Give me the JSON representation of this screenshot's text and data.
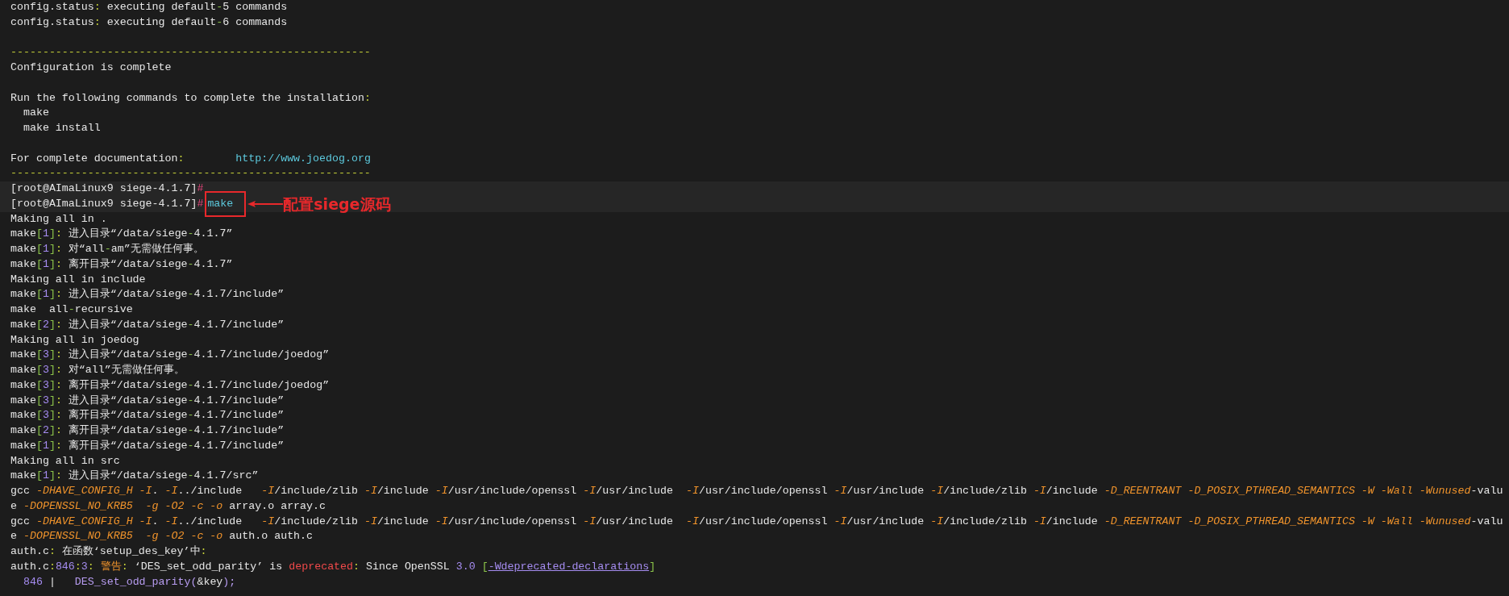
{
  "scrollback": [
    {
      "kind": "text",
      "segments": [
        {
          "text": "config.status",
          "kind": "plain"
        },
        {
          "text": ":",
          "kind": "punct"
        },
        {
          "text": " executing default",
          "kind": "plain"
        },
        {
          "text": "-",
          "kind": "dash"
        },
        {
          "text": "5 commands",
          "kind": "plain"
        }
      ]
    },
    {
      "kind": "text",
      "segments": [
        {
          "text": "config.status",
          "kind": "plain"
        },
        {
          "text": ":",
          "kind": "punct"
        },
        {
          "text": " executing default",
          "kind": "plain"
        },
        {
          "text": "-",
          "kind": "dash"
        },
        {
          "text": "6 commands",
          "kind": "plain"
        }
      ]
    },
    {
      "kind": "blank"
    },
    {
      "kind": "text",
      "segments": [
        {
          "text": "--------------------------------------------------------",
          "kind": "punct"
        }
      ]
    },
    {
      "kind": "text",
      "segments": [
        {
          "text": "Configuration is complete",
          "kind": "plain"
        }
      ]
    },
    {
      "kind": "blank"
    },
    {
      "kind": "text",
      "segments": [
        {
          "text": "Run the following commands to complete the installation",
          "kind": "plain"
        },
        {
          "text": ":",
          "kind": "punct"
        }
      ]
    },
    {
      "kind": "text",
      "segments": [
        {
          "text": "  make",
          "kind": "plain"
        }
      ]
    },
    {
      "kind": "text",
      "segments": [
        {
          "text": "  make install",
          "kind": "plain"
        }
      ]
    },
    {
      "kind": "blank"
    },
    {
      "kind": "text",
      "segments": [
        {
          "text": "For complete documentation",
          "kind": "plain"
        },
        {
          "text": ":        ",
          "kind": "punct"
        },
        {
          "text": "http://www.joedog.org",
          "kind": "url"
        }
      ]
    },
    {
      "kind": "text",
      "segments": [
        {
          "text": "--------------------------------------------------------",
          "kind": "punct"
        }
      ]
    }
  ],
  "highlighted_lines": [
    {
      "kind": "text",
      "segments": [
        {
          "text": "[root@AImaLinux9 siege-4.1.7]",
          "kind": "plain"
        },
        {
          "text": "#",
          "kind": "sign"
        }
      ]
    },
    {
      "kind": "text",
      "segments": [
        {
          "text": "[root@AImaLinux9 siege-4.1.7]",
          "kind": "plain"
        },
        {
          "text": "#",
          "kind": "sign"
        }
      ],
      "annotation": {
        "command": "make",
        "label": "配置siege源码"
      }
    }
  ],
  "output": [
    {
      "kind": "text",
      "segments": [
        {
          "text": "Making all in .",
          "kind": "plain"
        }
      ]
    },
    {
      "kind": "text",
      "segments": [
        {
          "text": "make",
          "kind": "plain"
        },
        {
          "text": "[",
          "kind": "dash"
        },
        {
          "text": "1",
          "kind": "number"
        },
        {
          "text": "]",
          "kind": "dash"
        },
        {
          "text": ":",
          "kind": "punct"
        },
        {
          "text": " 进入目录“/data/siege",
          "kind": "plain"
        },
        {
          "text": "-",
          "kind": "dash"
        },
        {
          "text": "4.1.7”",
          "kind": "plain"
        }
      ]
    },
    {
      "kind": "text",
      "segments": [
        {
          "text": "make",
          "kind": "plain"
        },
        {
          "text": "[",
          "kind": "dash"
        },
        {
          "text": "1",
          "kind": "number"
        },
        {
          "text": "]",
          "kind": "dash"
        },
        {
          "text": ":",
          "kind": "punct"
        },
        {
          "text": " 对“all",
          "kind": "plain"
        },
        {
          "text": "-",
          "kind": "dash"
        },
        {
          "text": "am”无需做任何事。",
          "kind": "plain"
        }
      ]
    },
    {
      "kind": "text",
      "segments": [
        {
          "text": "make",
          "kind": "plain"
        },
        {
          "text": "[",
          "kind": "dash"
        },
        {
          "text": "1",
          "kind": "number"
        },
        {
          "text": "]",
          "kind": "dash"
        },
        {
          "text": ":",
          "kind": "punct"
        },
        {
          "text": " 离开目录“/data/siege",
          "kind": "plain"
        },
        {
          "text": "-",
          "kind": "dash"
        },
        {
          "text": "4.1.7”",
          "kind": "plain"
        }
      ]
    },
    {
      "kind": "text",
      "segments": [
        {
          "text": "Making all in include",
          "kind": "plain"
        }
      ]
    },
    {
      "kind": "text",
      "segments": [
        {
          "text": "make",
          "kind": "plain"
        },
        {
          "text": "[",
          "kind": "dash"
        },
        {
          "text": "1",
          "kind": "number"
        },
        {
          "text": "]",
          "kind": "dash"
        },
        {
          "text": ":",
          "kind": "punct"
        },
        {
          "text": " 进入目录“/data/siege",
          "kind": "plain"
        },
        {
          "text": "-",
          "kind": "dash"
        },
        {
          "text": "4.1.7/include”",
          "kind": "plain"
        }
      ]
    },
    {
      "kind": "text",
      "segments": [
        {
          "text": "make  all",
          "kind": "plain"
        },
        {
          "text": "-",
          "kind": "dash"
        },
        {
          "text": "recursive",
          "kind": "plain"
        }
      ]
    },
    {
      "kind": "text",
      "segments": [
        {
          "text": "make",
          "kind": "plain"
        },
        {
          "text": "[",
          "kind": "dash"
        },
        {
          "text": "2",
          "kind": "number"
        },
        {
          "text": "]",
          "kind": "dash"
        },
        {
          "text": ":",
          "kind": "punct"
        },
        {
          "text": " 进入目录“/data/siege",
          "kind": "plain"
        },
        {
          "text": "-",
          "kind": "dash"
        },
        {
          "text": "4.1.7/include”",
          "kind": "plain"
        }
      ]
    },
    {
      "kind": "text",
      "segments": [
        {
          "text": "Making all in joedog",
          "kind": "plain"
        }
      ]
    },
    {
      "kind": "text",
      "segments": [
        {
          "text": "make",
          "kind": "plain"
        },
        {
          "text": "[",
          "kind": "dash"
        },
        {
          "text": "3",
          "kind": "number"
        },
        {
          "text": "]",
          "kind": "dash"
        },
        {
          "text": ":",
          "kind": "punct"
        },
        {
          "text": " 进入目录“/data/siege",
          "kind": "plain"
        },
        {
          "text": "-",
          "kind": "dash"
        },
        {
          "text": "4.1.7/include/joedog”",
          "kind": "plain"
        }
      ]
    },
    {
      "kind": "text",
      "segments": [
        {
          "text": "make",
          "kind": "plain"
        },
        {
          "text": "[",
          "kind": "dash"
        },
        {
          "text": "3",
          "kind": "number"
        },
        {
          "text": "]",
          "kind": "dash"
        },
        {
          "text": ":",
          "kind": "punct"
        },
        {
          "text": " 对“all”无需做任何事。",
          "kind": "plain"
        }
      ]
    },
    {
      "kind": "text",
      "segments": [
        {
          "text": "make",
          "kind": "plain"
        },
        {
          "text": "[",
          "kind": "dash"
        },
        {
          "text": "3",
          "kind": "number"
        },
        {
          "text": "]",
          "kind": "dash"
        },
        {
          "text": ":",
          "kind": "punct"
        },
        {
          "text": " 离开目录“/data/siege",
          "kind": "plain"
        },
        {
          "text": "-",
          "kind": "dash"
        },
        {
          "text": "4.1.7/include/joedog”",
          "kind": "plain"
        }
      ]
    },
    {
      "kind": "text",
      "segments": [
        {
          "text": "make",
          "kind": "plain"
        },
        {
          "text": "[",
          "kind": "dash"
        },
        {
          "text": "3",
          "kind": "number"
        },
        {
          "text": "]",
          "kind": "dash"
        },
        {
          "text": ":",
          "kind": "punct"
        },
        {
          "text": " 进入目录“/data/siege",
          "kind": "plain"
        },
        {
          "text": "-",
          "kind": "dash"
        },
        {
          "text": "4.1.7/include”",
          "kind": "plain"
        }
      ]
    },
    {
      "kind": "text",
      "segments": [
        {
          "text": "make",
          "kind": "plain"
        },
        {
          "text": "[",
          "kind": "dash"
        },
        {
          "text": "3",
          "kind": "number"
        },
        {
          "text": "]",
          "kind": "dash"
        },
        {
          "text": ":",
          "kind": "punct"
        },
        {
          "text": " 离开目录“/data/siege",
          "kind": "plain"
        },
        {
          "text": "-",
          "kind": "dash"
        },
        {
          "text": "4.1.7/include”",
          "kind": "plain"
        }
      ]
    },
    {
      "kind": "text",
      "segments": [
        {
          "text": "make",
          "kind": "plain"
        },
        {
          "text": "[",
          "kind": "dash"
        },
        {
          "text": "2",
          "kind": "number"
        },
        {
          "text": "]",
          "kind": "dash"
        },
        {
          "text": ":",
          "kind": "punct"
        },
        {
          "text": " 离开目录“/data/siege",
          "kind": "plain"
        },
        {
          "text": "-",
          "kind": "dash"
        },
        {
          "text": "4.1.7/include”",
          "kind": "plain"
        }
      ]
    },
    {
      "kind": "text",
      "segments": [
        {
          "text": "make",
          "kind": "plain"
        },
        {
          "text": "[",
          "kind": "dash"
        },
        {
          "text": "1",
          "kind": "number"
        },
        {
          "text": "]",
          "kind": "dash"
        },
        {
          "text": ":",
          "kind": "punct"
        },
        {
          "text": " 离开目录“/data/siege",
          "kind": "plain"
        },
        {
          "text": "-",
          "kind": "dash"
        },
        {
          "text": "4.1.7/include”",
          "kind": "plain"
        }
      ]
    },
    {
      "kind": "text",
      "segments": [
        {
          "text": "Making all in src",
          "kind": "plain"
        }
      ]
    },
    {
      "kind": "text",
      "segments": [
        {
          "text": "make",
          "kind": "plain"
        },
        {
          "text": "[",
          "kind": "dash"
        },
        {
          "text": "1",
          "kind": "number"
        },
        {
          "text": "]",
          "kind": "dash"
        },
        {
          "text": ":",
          "kind": "punct"
        },
        {
          "text": " 进入目录“/data/siege",
          "kind": "plain"
        },
        {
          "text": "-",
          "kind": "dash"
        },
        {
          "text": "4.1.7/src”",
          "kind": "plain"
        }
      ]
    },
    {
      "kind": "text",
      "segments": [
        {
          "text": "gcc ",
          "kind": "plain"
        },
        {
          "text": "-DHAVE_CONFIG_H -I",
          "kind": "flag"
        },
        {
          "text": ". ",
          "kind": "plain"
        },
        {
          "text": "-I",
          "kind": "flag"
        },
        {
          "text": "../include   ",
          "kind": "plain"
        },
        {
          "text": "-I",
          "kind": "flag"
        },
        {
          "text": "/include/zlib ",
          "kind": "plain"
        },
        {
          "text": "-I",
          "kind": "flag"
        },
        {
          "text": "/include ",
          "kind": "plain"
        },
        {
          "text": "-I",
          "kind": "flag"
        },
        {
          "text": "/usr/include/openssl ",
          "kind": "plain"
        },
        {
          "text": "-I",
          "kind": "flag"
        },
        {
          "text": "/usr/include  ",
          "kind": "plain"
        },
        {
          "text": "-I",
          "kind": "flag"
        },
        {
          "text": "/usr/include/openssl ",
          "kind": "plain"
        },
        {
          "text": "-I",
          "kind": "flag"
        },
        {
          "text": "/usr/include ",
          "kind": "plain"
        },
        {
          "text": "-I",
          "kind": "flag"
        },
        {
          "text": "/include/zlib ",
          "kind": "plain"
        },
        {
          "text": "-I",
          "kind": "flag"
        },
        {
          "text": "/include ",
          "kind": "plain"
        },
        {
          "text": "-D_REENTRANT -D_POSIX_PTHREAD_SEMANTICS -W -Wall -Wunused",
          "kind": "flag"
        },
        {
          "text": "-valu",
          "kind": "plain"
        }
      ]
    },
    {
      "kind": "text",
      "segments": [
        {
          "text": "e ",
          "kind": "plain"
        },
        {
          "text": "-DOPENSSL_NO_KRB5  -g -O2 -c -o",
          "kind": "flag"
        },
        {
          "text": " array.o array.c",
          "kind": "plain"
        }
      ]
    },
    {
      "kind": "text",
      "segments": [
        {
          "text": "gcc ",
          "kind": "plain"
        },
        {
          "text": "-DHAVE_CONFIG_H -I",
          "kind": "flag"
        },
        {
          "text": ". ",
          "kind": "plain"
        },
        {
          "text": "-I",
          "kind": "flag"
        },
        {
          "text": "../include   ",
          "kind": "plain"
        },
        {
          "text": "-I",
          "kind": "flag"
        },
        {
          "text": "/include/zlib ",
          "kind": "plain"
        },
        {
          "text": "-I",
          "kind": "flag"
        },
        {
          "text": "/include ",
          "kind": "plain"
        },
        {
          "text": "-I",
          "kind": "flag"
        },
        {
          "text": "/usr/include/openssl ",
          "kind": "plain"
        },
        {
          "text": "-I",
          "kind": "flag"
        },
        {
          "text": "/usr/include  ",
          "kind": "plain"
        },
        {
          "text": "-I",
          "kind": "flag"
        },
        {
          "text": "/usr/include/openssl ",
          "kind": "plain"
        },
        {
          "text": "-I",
          "kind": "flag"
        },
        {
          "text": "/usr/include ",
          "kind": "plain"
        },
        {
          "text": "-I",
          "kind": "flag"
        },
        {
          "text": "/include/zlib ",
          "kind": "plain"
        },
        {
          "text": "-I",
          "kind": "flag"
        },
        {
          "text": "/include ",
          "kind": "plain"
        },
        {
          "text": "-D_REENTRANT -D_POSIX_PTHREAD_SEMANTICS -W -Wall -Wunused",
          "kind": "flag"
        },
        {
          "text": "-valu",
          "kind": "plain"
        }
      ]
    },
    {
      "kind": "text",
      "segments": [
        {
          "text": "e ",
          "kind": "plain"
        },
        {
          "text": "-DOPENSSL_NO_KRB5  -g -O2 -c -o",
          "kind": "flag"
        },
        {
          "text": " auth.o auth.c",
          "kind": "plain"
        }
      ]
    },
    {
      "kind": "text",
      "segments": [
        {
          "text": "auth.c",
          "kind": "plain"
        },
        {
          "text": ":",
          "kind": "punct"
        },
        {
          "text": " 在函数‘setup_des_key’中",
          "kind": "plain"
        },
        {
          "text": ":",
          "kind": "punct"
        }
      ]
    },
    {
      "kind": "text",
      "segments": [
        {
          "text": "auth.c",
          "kind": "plain"
        },
        {
          "text": ":",
          "kind": "punct"
        },
        {
          "text": "846",
          "kind": "number"
        },
        {
          "text": ":",
          "kind": "punct"
        },
        {
          "text": "3",
          "kind": "number"
        },
        {
          "text": ": ",
          "kind": "punct"
        },
        {
          "text": "警告",
          "kind": "warning"
        },
        {
          "text": ":",
          "kind": "punct"
        },
        {
          "text": " ‘DES_set_odd_parity’ is ",
          "kind": "plain"
        },
        {
          "text": "deprecated",
          "kind": "error"
        },
        {
          "text": ":",
          "kind": "punct"
        },
        {
          "text": " Since OpenSSL ",
          "kind": "plain"
        },
        {
          "text": "3.0",
          "kind": "number"
        },
        {
          "text": " [",
          "kind": "dash"
        },
        {
          "text": "-Wdeprecated-declarations",
          "kind": "link"
        },
        {
          "text": "]",
          "kind": "dash"
        }
      ]
    },
    {
      "kind": "text",
      "segments": [
        {
          "text": "  846",
          "kind": "number"
        },
        {
          "text": " |   ",
          "kind": "plain"
        },
        {
          "text": "DES_set_odd_parity(",
          "kind": "code"
        },
        {
          "text": "&key",
          "kind": "plain"
        },
        {
          "text": ");",
          "kind": "code"
        }
      ]
    }
  ]
}
